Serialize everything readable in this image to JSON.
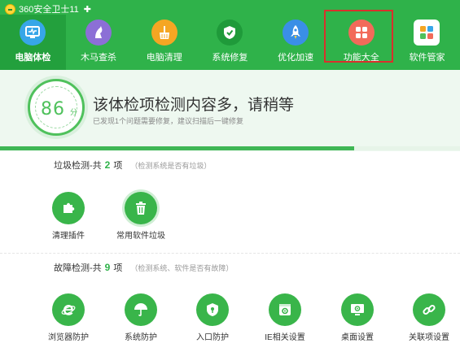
{
  "app": {
    "title": "360安全卫士11",
    "plus_symbol": "✚",
    "logo": "360-logo-icon"
  },
  "nav": {
    "items": [
      {
        "label": "电脑体检",
        "icon": "monitor-icon",
        "color": "#37a6e8",
        "active": true
      },
      {
        "label": "木马查杀",
        "icon": "horse-icon",
        "color": "#8c6fd6"
      },
      {
        "label": "电脑清理",
        "icon": "broom-icon",
        "color": "#f5a623"
      },
      {
        "label": "系统修复",
        "icon": "shield-icon",
        "color": "#1f9a3a"
      },
      {
        "label": "优化加速",
        "icon": "rocket-icon",
        "color": "#3a8fe6"
      },
      {
        "label": "功能大全",
        "icon": "grid-icon",
        "color": "#f26a5a"
      },
      {
        "label": "软件管家",
        "icon": "software-icon",
        "color": "#ffffff"
      }
    ]
  },
  "score": {
    "value": "86",
    "unit": "分",
    "headline": "该体检项检测内容多，请稍等",
    "subline": "已发现1个问题需要修复，建议扫描后一键修复",
    "progress": 0.77
  },
  "sections": [
    {
      "title": "垃圾检测-共",
      "count": "2",
      "unit": "项",
      "note": "（检测系统是否有垃圾）",
      "tools": [
        {
          "label": "清理插件",
          "icon": "puzzle-icon"
        },
        {
          "label": "常用软件垃圾",
          "icon": "trash-icon"
        }
      ]
    },
    {
      "title": "故障检测-共",
      "count": "9",
      "unit": "项",
      "note": "（检测系统、软件是否有故障）",
      "tools": [
        {
          "label": "浏览器防护",
          "icon": "ie-icon"
        },
        {
          "label": "系统防护",
          "icon": "umbrella-icon"
        },
        {
          "label": "入口防护",
          "icon": "shield-lock-icon"
        },
        {
          "label": "IE相关设置",
          "icon": "ie-settings-icon"
        },
        {
          "label": "桌面设置",
          "icon": "desktop-icon"
        },
        {
          "label": "关联项设置",
          "icon": "link-icon"
        }
      ]
    }
  ]
}
